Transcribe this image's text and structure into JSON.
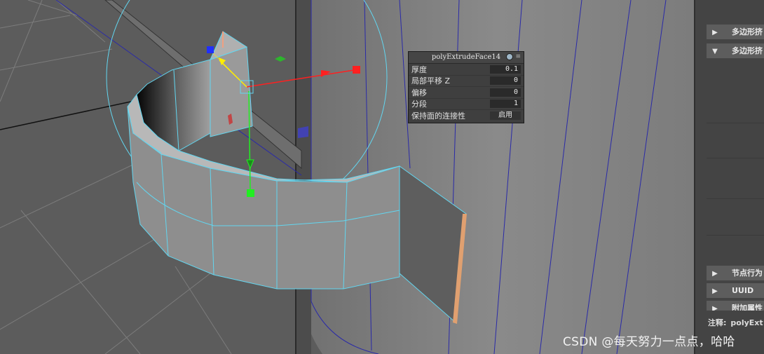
{
  "inview_editor": {
    "title": "polyExtrudeFace14",
    "rows": [
      {
        "label": "厚度",
        "value": "0.1"
      },
      {
        "label": "局部平移 Z",
        "value": "0"
      },
      {
        "label": "偏移",
        "value": "0"
      },
      {
        "label": "分段",
        "value": "1"
      },
      {
        "label": "保持面的连接性",
        "value": "启用"
      }
    ]
  },
  "attribute_panel": {
    "sections": [
      {
        "label": "多边形挤",
        "state": "collapsed"
      },
      {
        "label": "多边形挤",
        "state": "expanded"
      },
      {
        "label": "节点行为",
        "state": "collapsed"
      },
      {
        "label": "UUID",
        "state": "collapsed"
      },
      {
        "label": "附加属性",
        "state": "collapsed"
      }
    ],
    "note_label": "注释:",
    "note_value": "polyExt"
  },
  "watermark": "CSDN @每天努力一点点，哈哈",
  "colors": {
    "viewport_bg": "#5a5a5a",
    "wireframe": "#62d6f0",
    "axis_x": "#ff2020",
    "axis_y": "#ffee00",
    "axis_z": "#22ee22",
    "axis_blue": "#2030ff"
  },
  "icons": [
    "expand-arrow-icon",
    "collapse-arrow-icon",
    "manipulator-x-handle",
    "manipulator-y-handle",
    "manipulator-z-handle"
  ]
}
